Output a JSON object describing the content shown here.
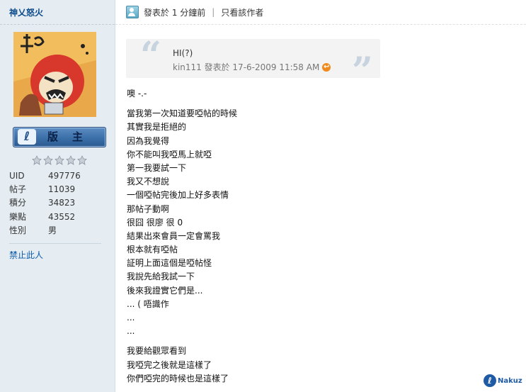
{
  "sidebar": {
    "username": "神乂怒火",
    "rank_title": "版主",
    "stats": [
      {
        "label": "UID",
        "value": "497776"
      },
      {
        "label": "帖子",
        "value": "11039"
      },
      {
        "label": "積分",
        "value": "34823"
      },
      {
        "label": "樂點",
        "value": "43552"
      },
      {
        "label": "性別",
        "value": "男"
      }
    ],
    "ban_link": "禁止此人"
  },
  "post_header": {
    "posted_at": "發表於 1 分鐘前",
    "separator": "|",
    "author_only_link": "只看該作者"
  },
  "quote": {
    "text": "HI(?)",
    "meta": "kin111 發表於 17-6-2009 11:58 AM"
  },
  "post_body": {
    "paragraph_1": [
      "噢 -.-"
    ],
    "paragraph_2": [
      "當我第一次知道要啞帖的時候",
      "其實我是拒絕的",
      "因為我覺得",
      "你不能叫我啞馬上就啞",
      "第一我要試一下",
      "我又不想說",
      "一個啞帖完後加上好多表情",
      "那帖子動啊",
      "很囧 很廖 很 0",
      "結果出來會員一定會罵我",
      "根本就有啞帖",
      "証明上面這個是啞帖怪",
      "我說先給我試一下",
      "後來我證實它們是...",
      "... ( 唔識作",
      "...",
      "..."
    ],
    "paragraph_3": [
      "我要給觀眾看到",
      "我啞完之後就是這樣了",
      "你們啞完的時候也是這樣了"
    ]
  },
  "watermark": "Nakuz",
  "colors": {
    "sidebar_bg": "#e5edf2",
    "username": "#0a4a8a",
    "link": "#0a5aa8",
    "quote_bg": "#f3f3f3"
  }
}
